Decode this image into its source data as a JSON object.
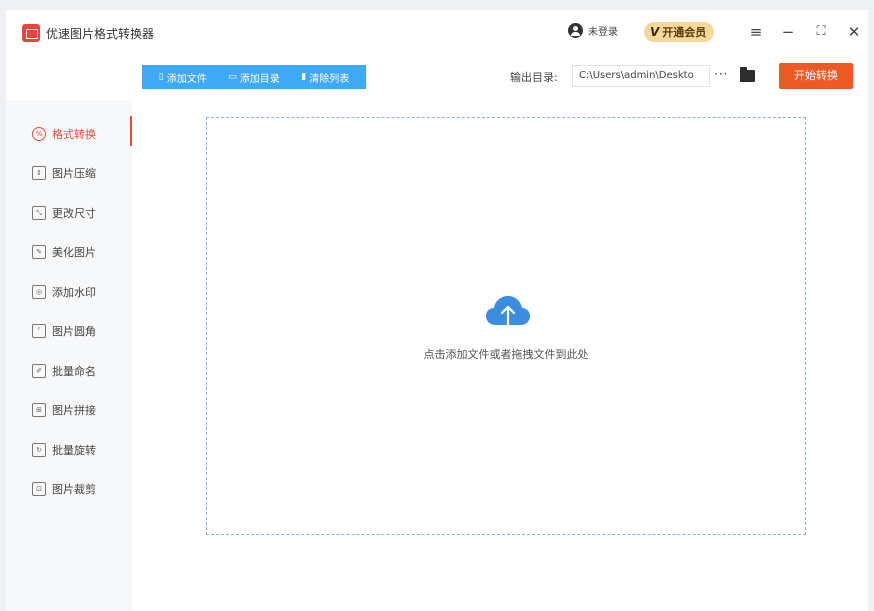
{
  "app": {
    "title": "优速图片格式转换器"
  },
  "header": {
    "login_label": "未登录",
    "vip_label": "开通会员",
    "vip_icon": "V"
  },
  "toolbar": {
    "add_file": "添加文件",
    "add_folder": "添加目录",
    "clear_list": "清除列表",
    "output_label": "输出目录:",
    "output_path": "C:\\Users\\admin\\Deskto",
    "more": "···",
    "start": "开始转换"
  },
  "sidebar": {
    "items": [
      {
        "label": "格式转换",
        "icon": "%",
        "active": true
      },
      {
        "label": "图片压缩",
        "icon": "⇕"
      },
      {
        "label": "更改尺寸",
        "icon": "⤡"
      },
      {
        "label": "美化图片",
        "icon": "✎"
      },
      {
        "label": "添加水印",
        "icon": "◎"
      },
      {
        "label": "图片圆角",
        "icon": "⌜"
      },
      {
        "label": "批量命名",
        "icon": "✐"
      },
      {
        "label": "图片拼接",
        "icon": "⊞"
      },
      {
        "label": "批量旋转",
        "icon": "↻"
      },
      {
        "label": "图片裁剪",
        "icon": "⊡"
      }
    ]
  },
  "main": {
    "drop_hint": "点击添加文件或者拖拽文件到此处"
  },
  "colors": {
    "accent": "#e94b35",
    "toolbar_blue": "#3fa9f5",
    "start_orange": "#ee5a24",
    "cloud_blue": "#3b8de0"
  }
}
